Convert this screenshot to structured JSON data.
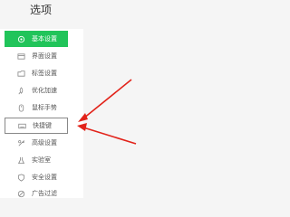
{
  "title": "选项",
  "colors": {
    "accent": "#21c45a",
    "annotation": "#e2231a"
  },
  "sidebar": {
    "items": [
      {
        "label": "基本设置",
        "icon": "gear-icon"
      },
      {
        "label": "界面设置",
        "icon": "window-icon"
      },
      {
        "label": "标签设置",
        "icon": "tab-icon"
      },
      {
        "label": "优化加速",
        "icon": "rocket-icon"
      },
      {
        "label": "鼠标手势",
        "icon": "mouse-icon"
      },
      {
        "label": "快捷键",
        "icon": "keyboard-icon"
      },
      {
        "label": "高级设置",
        "icon": "advanced-icon"
      },
      {
        "label": "实验室",
        "icon": "flask-icon"
      },
      {
        "label": "安全设置",
        "icon": "shield-icon"
      },
      {
        "label": "广告过滤",
        "icon": "ad-filter-icon"
      }
    ]
  }
}
